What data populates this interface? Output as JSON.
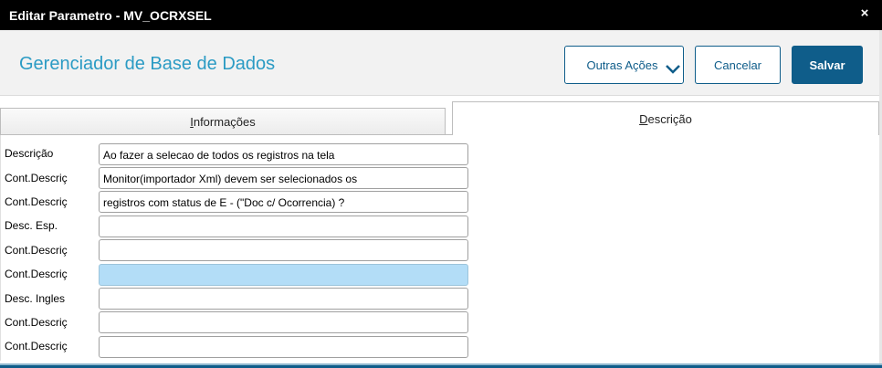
{
  "window": {
    "title": "Editar Parametro - MV_OCRXSEL",
    "close_glyph": "×"
  },
  "header": {
    "app_title": "Gerenciador de Base de Dados",
    "buttons": {
      "outras": "Outras Ações",
      "cancelar": "Cancelar",
      "salvar": "Salvar"
    }
  },
  "tabs": [
    {
      "label": "Informações",
      "active": false
    },
    {
      "label": "Descrição",
      "active": true
    }
  ],
  "form": {
    "rows": [
      {
        "label": "Descrição",
        "value": "Ao fazer a selecao de todos os registros na tela"
      },
      {
        "label": "Cont.Descriç",
        "value": "Monitor(importador Xml) devem ser selecionados os"
      },
      {
        "label": "Cont.Descriç",
        "value": "registros com status de E - (\"Doc c/ Ocorrencia) ?"
      },
      {
        "label": "Desc. Esp.",
        "value": ""
      },
      {
        "label": "Cont.Descriç",
        "value": ""
      },
      {
        "label": "Cont.Descriç",
        "value": "",
        "focused": true
      },
      {
        "label": "Desc. Ingles",
        "value": ""
      },
      {
        "label": "Cont.Descriç",
        "value": ""
      },
      {
        "label": "Cont.Descriç",
        "value": ""
      }
    ]
  },
  "colors": {
    "accent": "#0f5d8a",
    "title": "#2b9bc4",
    "focused_field": "#b3ddf7"
  }
}
